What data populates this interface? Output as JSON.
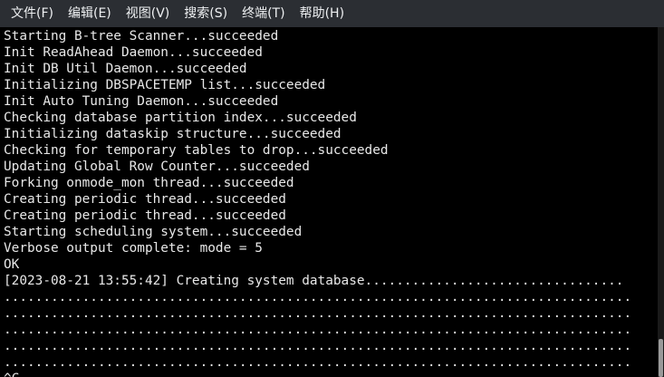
{
  "menu": {
    "items": [
      {
        "label": "文件(F)"
      },
      {
        "label": "编辑(E)"
      },
      {
        "label": "视图(V)"
      },
      {
        "label": "搜索(S)"
      },
      {
        "label": "终端(T)"
      },
      {
        "label": "帮助(H)"
      }
    ]
  },
  "terminal": {
    "lines": [
      "Starting B-tree Scanner...succeeded",
      "Init ReadAhead Daemon...succeeded",
      "Init DB Util Daemon...succeeded",
      "Initializing DBSPACETEMP list...succeeded",
      "Init Auto Tuning Daemon...succeeded",
      "Checking database partition index...succeeded",
      "Initializing dataskip structure...succeeded",
      "Checking for temporary tables to drop...succeeded",
      "Updating Global Row Counter...succeeded",
      "Forking onmode_mon thread...succeeded",
      "Creating periodic thread...succeeded",
      "Creating periodic thread...succeeded",
      "Starting scheduling system...succeeded",
      "Verbose output complete: mode = 5",
      "OK",
      "[2023-08-21 13:55:42] Creating system database.................................",
      "................................................................................",
      "................................................................................",
      "................................................................................",
      "................................................................................",
      "................................................................................",
      "^C"
    ]
  },
  "colors": {
    "menubar_bg": "#2b2e33",
    "menubar_text": "#eef0f2",
    "terminal_bg": "#000000",
    "terminal_text": "#e8e8e8"
  }
}
